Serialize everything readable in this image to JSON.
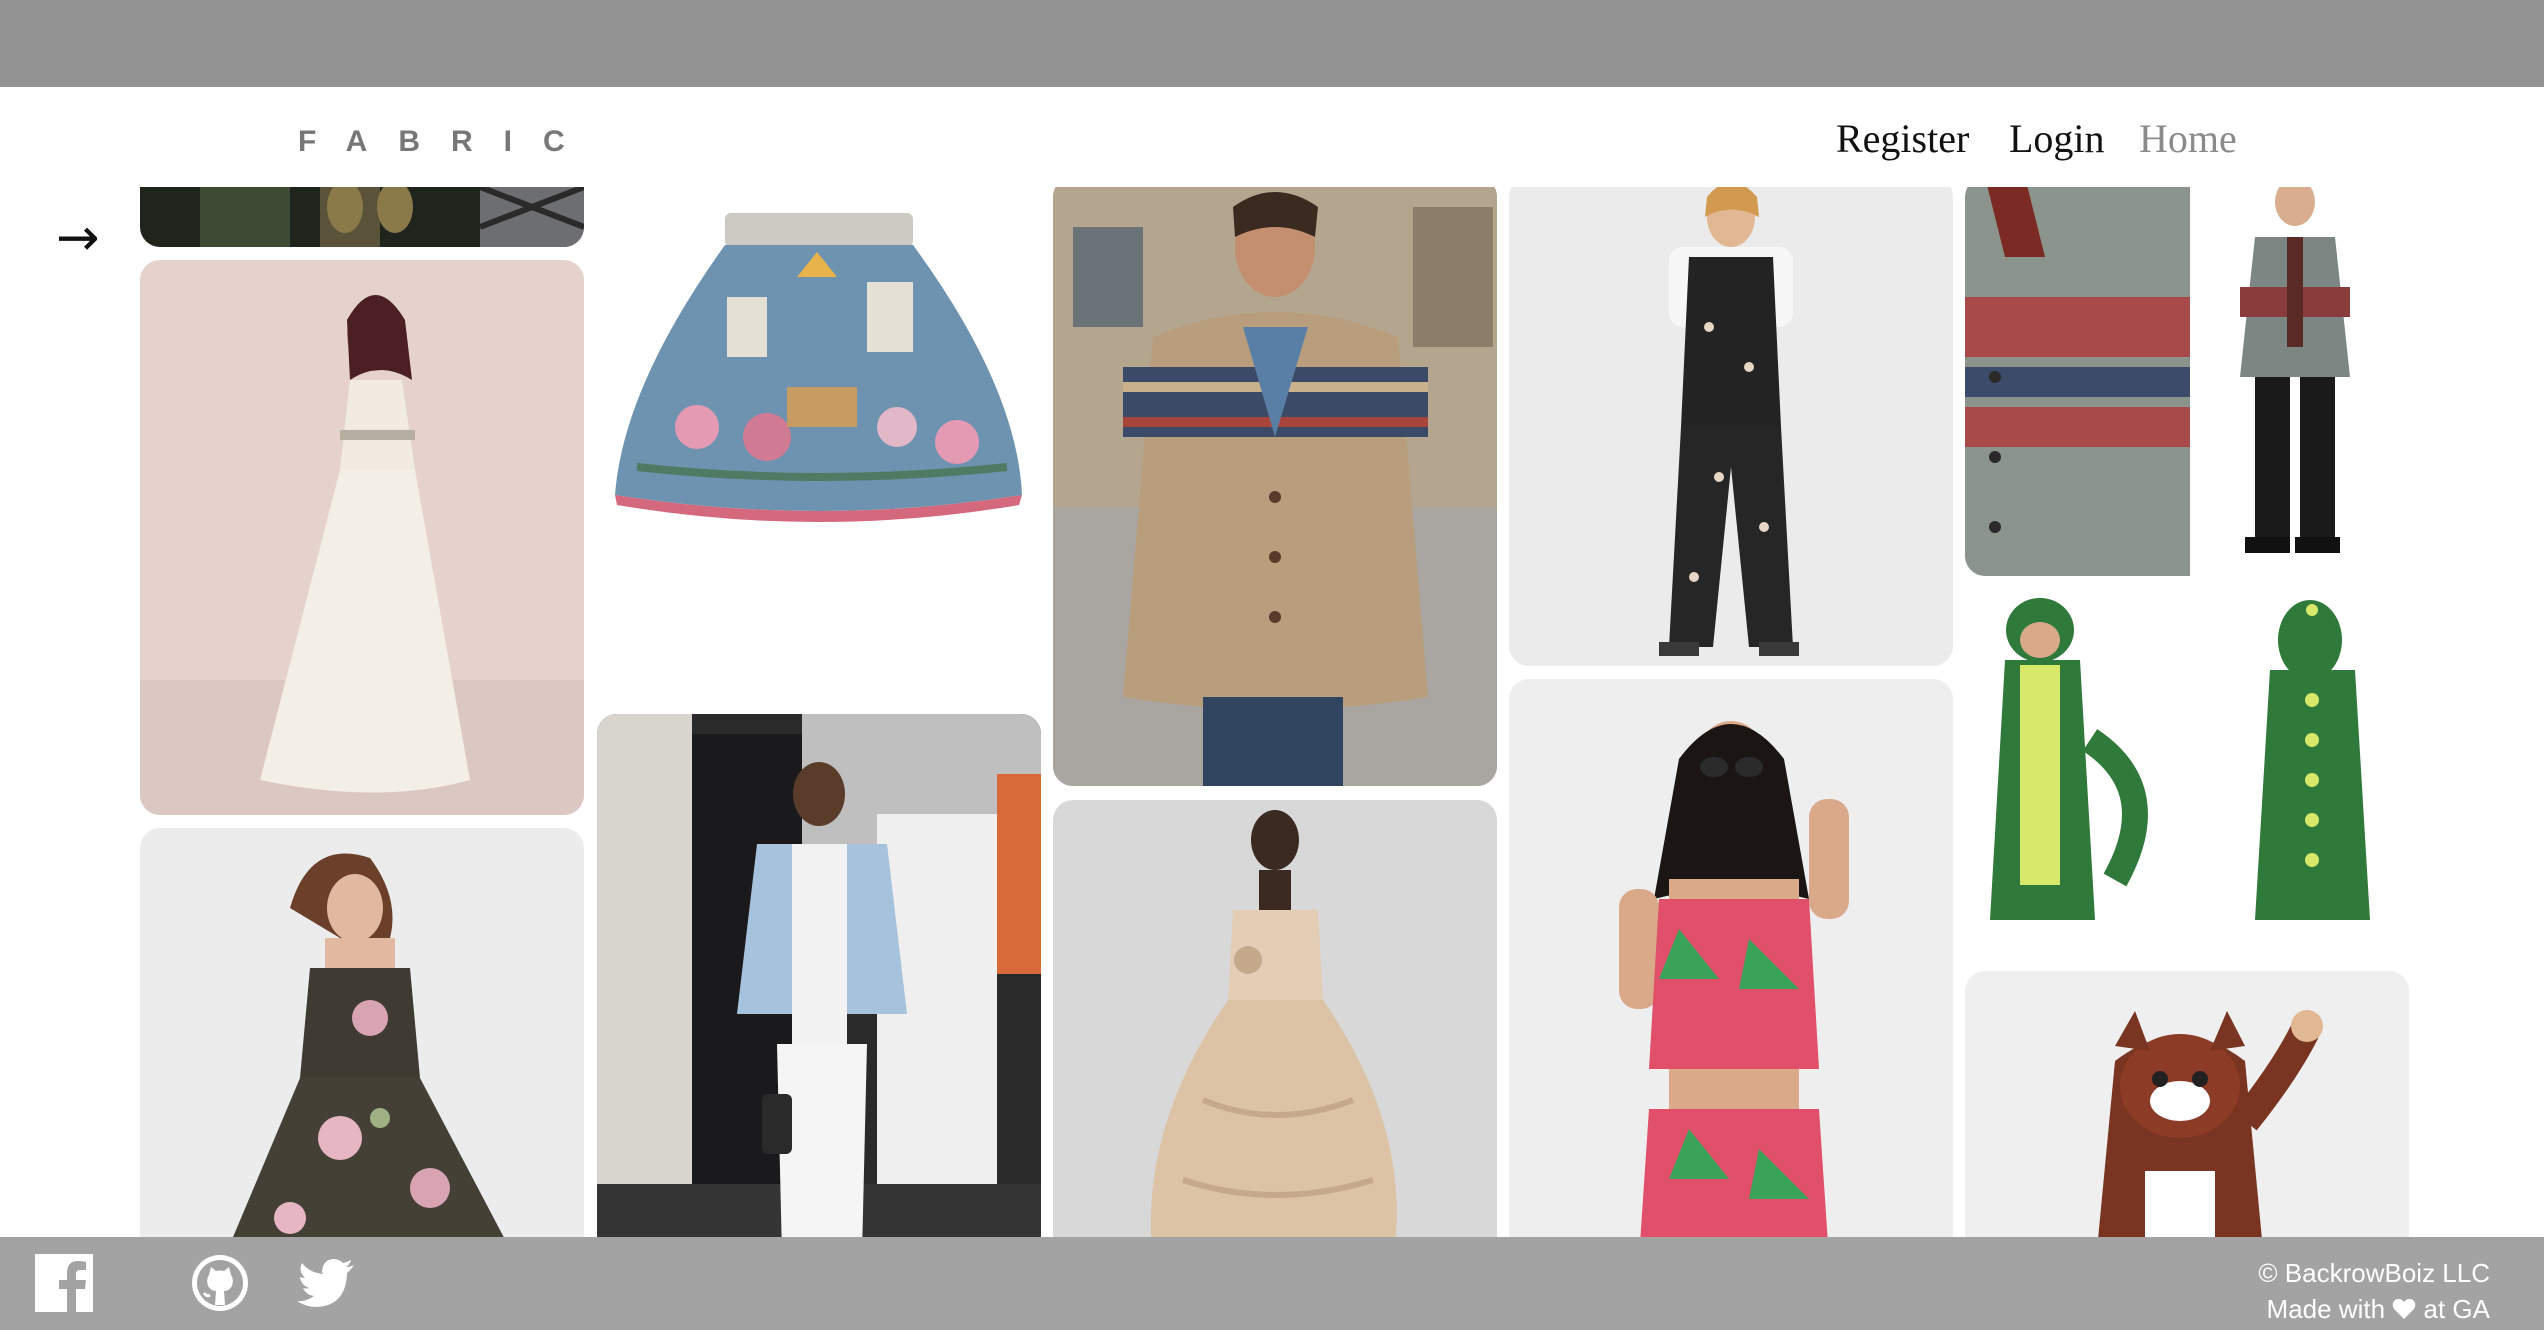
{
  "header": {
    "logo": "FABRIC",
    "nav": {
      "register": "Register",
      "login": "Login",
      "home": "Home"
    }
  },
  "arrow": "→",
  "tiles": [
    {
      "name": "dark-plaid-outfit-image",
      "icon": "image"
    },
    {
      "name": "white-gown-image",
      "icon": "image"
    },
    {
      "name": "floral-strapless-dress-image",
      "icon": "image"
    },
    {
      "name": "printed-blue-skirt-image",
      "icon": "image"
    },
    {
      "name": "denim-jacket-outfit-image",
      "icon": "image"
    },
    {
      "name": "shawl-cardigan-image",
      "icon": "image"
    },
    {
      "name": "beige-ruffle-gown-image",
      "icon": "image"
    },
    {
      "name": "floral-jumpsuit-image",
      "icon": "image"
    },
    {
      "name": "watermelon-print-set-image",
      "icon": "image"
    },
    {
      "name": "patterned-cardigan-image",
      "icon": "image"
    },
    {
      "name": "dinosaur-onesie-image",
      "icon": "image"
    },
    {
      "name": "red-panda-onesie-image",
      "icon": "image"
    }
  ],
  "footer": {
    "icons": [
      "facebook-icon",
      "github-icon",
      "twitter-icon"
    ],
    "copyright": "© BackrowBoiz LLC",
    "made_with_prefix": "Made with",
    "made_with_suffix": "at GA"
  },
  "colors": {
    "top_band": "#939393",
    "footer": "#a3a3a3",
    "nav_active": "#111111",
    "nav_muted": "#8a8a8a"
  }
}
